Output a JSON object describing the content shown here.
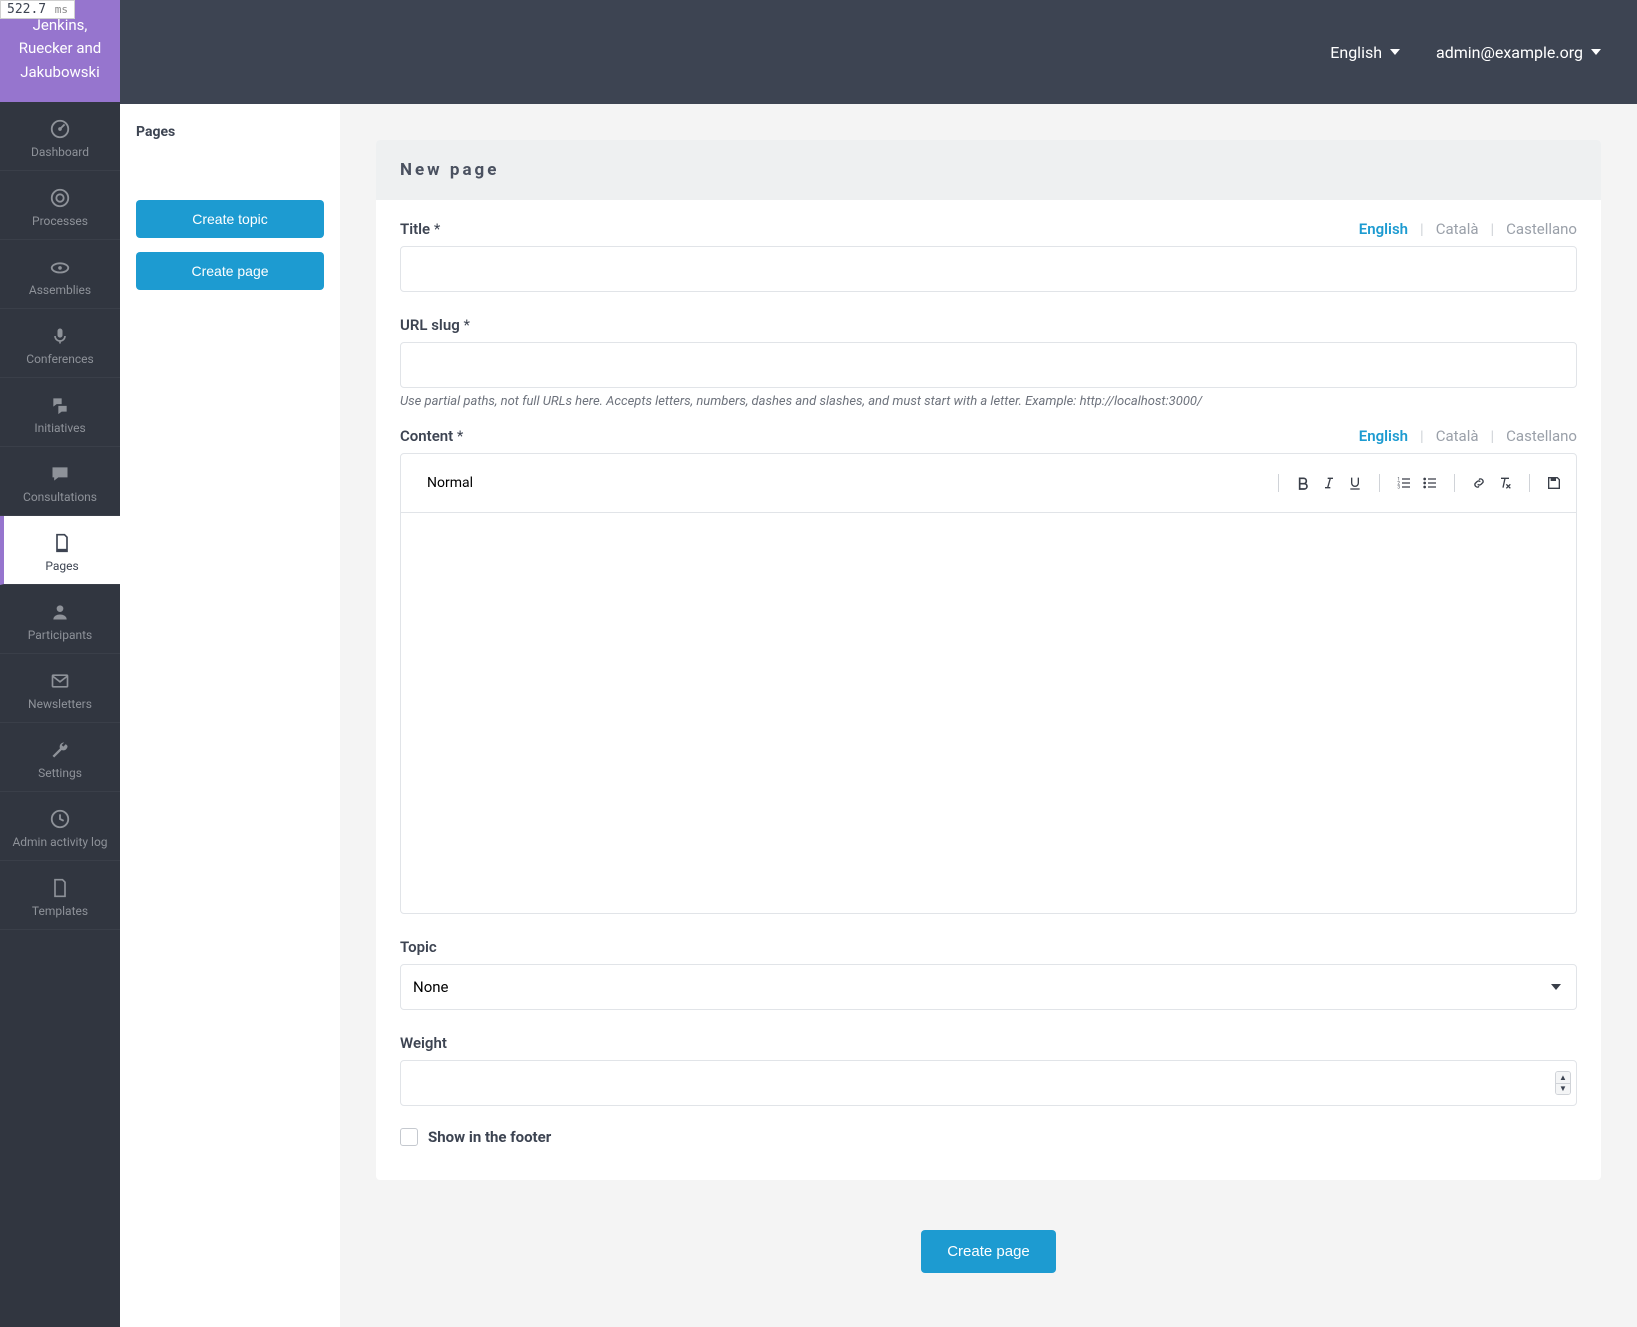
{
  "perf_ms": "522.7",
  "org_name": "Jenkins, Ruecker and Jakubowski",
  "topbar": {
    "language": "English",
    "user": "admin@example.org"
  },
  "sidebar": {
    "items": [
      {
        "label": "Dashboard"
      },
      {
        "label": "Processes"
      },
      {
        "label": "Assemblies"
      },
      {
        "label": "Conferences"
      },
      {
        "label": "Initiatives"
      },
      {
        "label": "Consultations"
      },
      {
        "label": "Pages"
      },
      {
        "label": "Participants"
      },
      {
        "label": "Newsletters"
      },
      {
        "label": "Settings"
      },
      {
        "label": "Admin activity log"
      },
      {
        "label": "Templates"
      }
    ]
  },
  "secpanel": {
    "title": "Pages",
    "create_topic": "Create topic",
    "create_page": "Create page"
  },
  "form": {
    "heading": "New page",
    "title_label": "Title",
    "url_label": "URL slug",
    "url_hint": "Use partial paths, not full URLs here. Accepts letters, numbers, dashes and slashes, and must start with a letter. Example: http://localhost:3000/",
    "content_label": "Content",
    "topic_label": "Topic",
    "topic_value": "None",
    "weight_label": "Weight",
    "footer_label": "Show in the footer",
    "submit": "Create page",
    "languages": {
      "en": "English",
      "ca": "Català",
      "es": "Castellano"
    },
    "editor": {
      "format": "Normal"
    }
  }
}
